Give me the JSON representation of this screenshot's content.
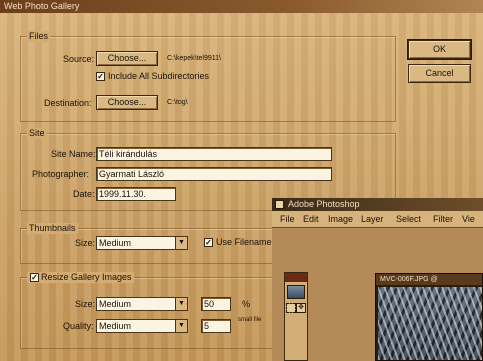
{
  "window": {
    "title": "Web Photo Gallery"
  },
  "buttons": {
    "ok": "OK",
    "cancel": "Cancel"
  },
  "files": {
    "legend": "Files",
    "source_label": "Source:",
    "source_button": "Choose...",
    "source_path": "C:\\kepek\\tel9911\\",
    "include_subdirs_label": "Include All Subdirectories",
    "include_subdirs_checked": true,
    "destination_label": "Destination:",
    "destination_button": "Choose...",
    "destination_path": "C:\\tog\\"
  },
  "site": {
    "legend": "Site",
    "site_name_label": "Site Name:",
    "site_name_value": "Téli kirándulás",
    "photographer_label": "Photographer:",
    "photographer_value": "Gyarmati László",
    "date_label": "Date:",
    "date_value": "1999.11.30."
  },
  "thumbnails": {
    "legend": "Thumbnails",
    "size_label": "Size:",
    "size_value": "Medium",
    "use_filename_label": "Use Filename a",
    "use_filename_checked": true
  },
  "resize": {
    "legend": "Resize Gallery Images",
    "checked": true,
    "size_label": "Size:",
    "size_value": "Medium",
    "size_number": "50",
    "size_unit": "%",
    "quality_label": "Quality:",
    "quality_value": "Medium",
    "quality_number": "5",
    "quality_note": "small file"
  },
  "photoshop": {
    "title": "Adobe Photoshop",
    "menus": [
      "File",
      "Edit",
      "Image",
      "Layer",
      "Select",
      "Filter",
      "Vie"
    ],
    "document_title": "MVC-006F.JPG @"
  }
}
